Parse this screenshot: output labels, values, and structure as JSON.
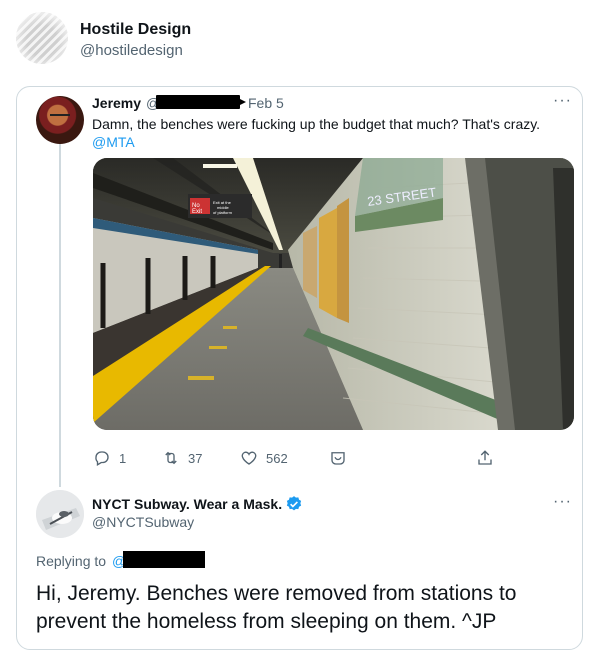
{
  "account": {
    "name": "Hostile Design",
    "handle": "@hostiledesign"
  },
  "quoted_tweet": {
    "author_name": "Jeremy",
    "handle_prefix": "@",
    "date": "Feb 5",
    "text": "Damn, the benches were fucking up the budget that much? That's crazy.",
    "mention": "@MTA",
    "more_icon": "···",
    "photo": {
      "sign_text_red": "No Exit",
      "sign_text_white": "Exit at the middle of platform",
      "wall_text": "23 STREET"
    },
    "actions": {
      "reply_count": "1",
      "retweet_count": "37",
      "like_count": "562"
    }
  },
  "reply_tweet": {
    "author_name": "NYCT Subway. Wear a Mask.",
    "handle": "@NYCTSubway",
    "more_icon": "···",
    "replying_label": "Replying to",
    "replying_at": "@",
    "text": "Hi, Jeremy. Benches were removed from stations to prevent the homeless from sleeping on them. ^JP"
  },
  "colors": {
    "accent": "#1d9bf0",
    "muted": "#536471",
    "border": "#cfd9de"
  },
  "icons": [
    "reply-icon",
    "retweet-icon",
    "like-icon",
    "react-icon",
    "share-icon",
    "more-icon",
    "verified-badge-icon"
  ]
}
